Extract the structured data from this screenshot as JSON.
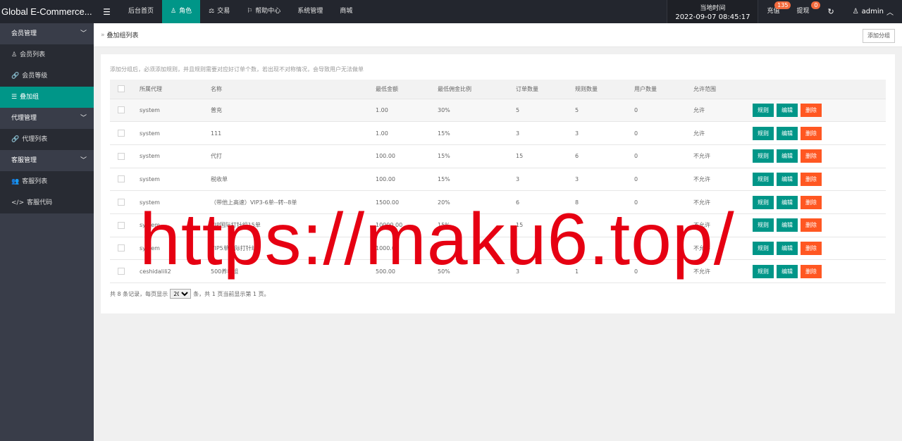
{
  "brand": "Global E-Commerce...",
  "nav": [
    {
      "label": "后台首页",
      "icon": ""
    },
    {
      "label": "角色",
      "icon": "♙"
    },
    {
      "label": "交易",
      "icon": "⚖"
    },
    {
      "label": "帮助中心",
      "icon": "⚐"
    },
    {
      "label": "系统管理",
      "icon": ""
    },
    {
      "label": "商城",
      "icon": ""
    }
  ],
  "header": {
    "time_label": "当地时间",
    "time_value": "2022-09-07 08:45:17",
    "recharge_label": "充值",
    "recharge_badge": "135",
    "withdraw_label": "提现",
    "withdraw_badge": "0",
    "admin_label": "admin"
  },
  "sidebar": {
    "groups": [
      {
        "label": "会员管理",
        "items": [
          {
            "label": "会员列表",
            "icon": "♙"
          },
          {
            "label": "会员等级",
            "icon": "🔗"
          },
          {
            "label": "叠加组",
            "icon": "☰"
          }
        ]
      },
      {
        "label": "代理管理",
        "items": [
          {
            "label": "代理列表",
            "icon": "🔗"
          }
        ]
      },
      {
        "label": "客服管理",
        "items": [
          {
            "label": "客服列表",
            "icon": "👥"
          },
          {
            "label": "客服代码",
            "icon": "</>"
          }
        ]
      }
    ]
  },
  "breadcrumb": "叠加组列表",
  "add_group_label": "添加分组",
  "notice": "添加分组后，必须添加规则，并且规则需要对应好订单个数，若出现不对称情况，会导致用户无法做单",
  "table": {
    "headers": [
      "所属代理",
      "名称",
      "最低金额",
      "最低佣金比例",
      "订单数量",
      "规则数量",
      "用户数量",
      "允许范围"
    ],
    "actions": [
      "规则",
      "编辑",
      "删除"
    ],
    "rows": [
      [
        "system",
        "普充",
        "1.00",
        "30%",
        "5",
        "5",
        "0",
        "允许"
      ],
      [
        "system",
        "111",
        "1.00",
        "15%",
        "3",
        "3",
        "0",
        "允许"
      ],
      [
        "system",
        "代打",
        "100.00",
        "15%",
        "15",
        "6",
        "0",
        "不允许"
      ],
      [
        "system",
        "税收单",
        "100.00",
        "15%",
        "3",
        "3",
        "0",
        "不允许"
      ],
      [
        "system",
        "（带他上高速）VIP3-6单--转--8单",
        "1500.00",
        "20%",
        "6",
        "8",
        "0",
        "不允许"
      ],
      [
        "system",
        "VIP国际打针组15单",
        "10000.00",
        "15%",
        "15",
        "",
        "",
        "不允许"
      ],
      [
        "system",
        "VIP5单国际打针组",
        "1000.00",
        "",
        "",
        "",
        "",
        "不允许"
      ],
      [
        "ceshidalili2",
        "500养春组",
        "500.00",
        "50%",
        "3",
        "1",
        "0",
        "不允许"
      ]
    ]
  },
  "pager": {
    "prefix": "共 8 条记录，每页显示",
    "page_size": "20",
    "suffix": "条，共 1 页当前显示第 1 页。"
  },
  "watermark": "https://maku6.top/"
}
